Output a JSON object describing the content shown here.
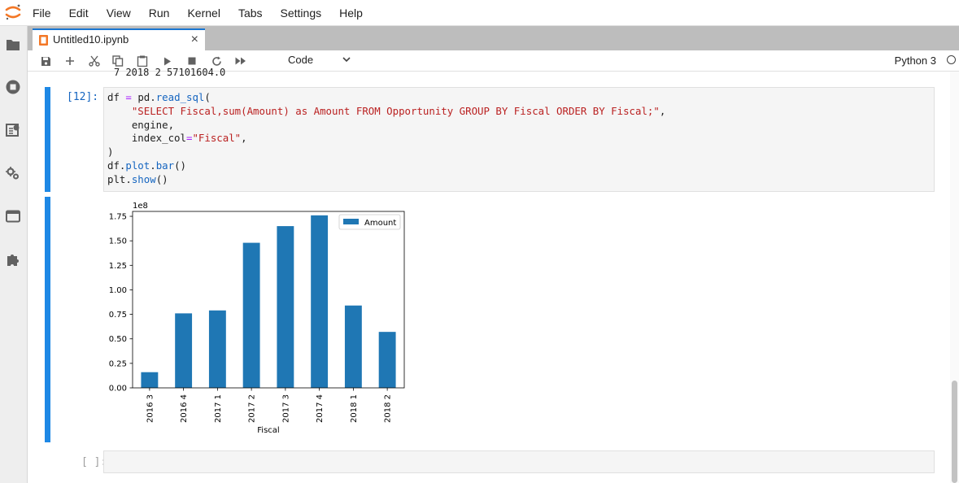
{
  "menubar": {
    "items": [
      "File",
      "Edit",
      "View",
      "Run",
      "Kernel",
      "Tabs",
      "Settings",
      "Help"
    ]
  },
  "tab": {
    "title": "Untitled10.ipynb",
    "close_icon": "×"
  },
  "toolbar": {
    "cell_type": "Code",
    "kernel": "Python 3"
  },
  "previous_output": "7  2018 2   57101604.0",
  "code_cell": {
    "prompt": "[12]:",
    "lines": [
      "df = pd.read_sql(",
      "    \"SELECT Fiscal,sum(Amount) as Amount FROM Opportunity GROUP BY Fiscal ORDER BY Fiscal;\",",
      "    engine,",
      "    index_col=\"Fiscal\",",
      ")",
      "df.plot.bar()",
      "plt.show()"
    ]
  },
  "empty_cell": {
    "prompt": "[ ]:"
  },
  "colors": {
    "bar": "#1f77b4",
    "collapser": "#1e88e5",
    "prompt": "#1565c0"
  },
  "chart_data": {
    "type": "bar",
    "categories": [
      "2016 3",
      "2016 4",
      "2017 1",
      "2017 2",
      "2017 3",
      "2017 4",
      "2018 1",
      "2018 2"
    ],
    "series": [
      {
        "name": "Amount",
        "values": [
          16000000,
          76000000,
          79000000,
          148000000,
          165000000,
          176000000,
          84000000,
          57101604
        ]
      }
    ],
    "xlabel": "Fiscal",
    "ylabel": "",
    "scale_label": "1e8",
    "yticks": [
      "0.00",
      "0.25",
      "0.50",
      "0.75",
      "1.00",
      "1.25",
      "1.50",
      "1.75"
    ],
    "ylim": [
      0,
      180000000
    ],
    "legend": "top-right",
    "grid": false
  }
}
